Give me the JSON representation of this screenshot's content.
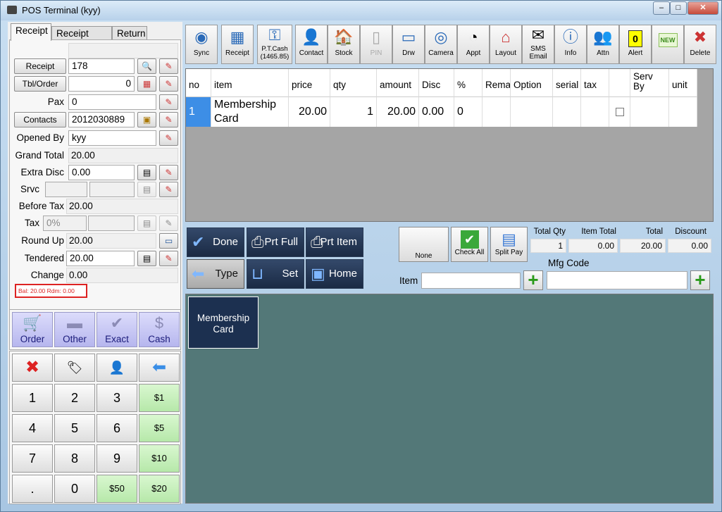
{
  "window": {
    "title": "POS Terminal (kyy)",
    "min": "–",
    "max": "□",
    "close": "✕"
  },
  "tabs": [
    "Receipt",
    "Receipt Info",
    "Return"
  ],
  "form": {
    "top_value": "",
    "receipt_label": "Receipt",
    "receipt_value": "178",
    "tbl_label": "Tbl/Order",
    "tbl_value": "0",
    "pax_label": "Pax",
    "pax_value": "0",
    "contacts_label": "Contacts",
    "contacts_value": "2012030889",
    "opened_by_label": "Opened By",
    "opened_by_value": "kyy",
    "grand_total_label": "Grand Total",
    "grand_total_value": "20.00",
    "extra_disc_label": "Extra Disc",
    "extra_disc_value": "0.00",
    "srvc_label": "Srvc",
    "before_tax_label": "Before Tax",
    "before_tax_value": "20.00",
    "tax_label": "Tax",
    "tax_value": "0%",
    "round_up_label": "Round Up",
    "round_up_value": "20.00",
    "tendered_label": "Tendered",
    "tendered_value": "20.00",
    "change_label": "Change",
    "change_value": "0.00",
    "balance_text": "Bal: 20.00 Rdm: 0.00"
  },
  "payments": [
    "Order",
    "Other",
    "Exact",
    "Cash"
  ],
  "keypad": {
    "digits": [
      "1",
      "2",
      "3",
      "4",
      "5",
      "6",
      "7",
      "8",
      "9",
      ".",
      "0"
    ],
    "money": [
      "$1",
      "$5",
      "$10",
      "$50",
      "$20"
    ]
  },
  "toolbar": [
    {
      "label": "Sync",
      "icon": "sync-icon"
    },
    {
      "label": "Receipt",
      "icon": "receipt-icon"
    },
    {
      "label": "P.T.Cash (1465.85)",
      "icon": "key-icon"
    },
    {
      "label": "Contact",
      "icon": "contact-icon"
    },
    {
      "label": "Stock",
      "icon": "house-icon"
    },
    {
      "label": "PIN",
      "icon": "phone-icon"
    },
    {
      "label": "Drw",
      "icon": "drawer-icon"
    },
    {
      "label": "Camera",
      "icon": "camera-icon"
    },
    {
      "label": "Appt",
      "icon": "appointment-icon"
    },
    {
      "label": "Layout",
      "icon": "shop-icon"
    },
    {
      "label": "SMS Email",
      "icon": "email-icon"
    },
    {
      "label": "Info",
      "icon": "info-icon"
    },
    {
      "label": "Attn",
      "icon": "attendance-icon"
    },
    {
      "label": "Alert",
      "icon": "alert-icon",
      "badge": "0"
    },
    {
      "label": "",
      "icon": "new-icon",
      "badge": "NEW"
    },
    {
      "label": "Delete",
      "icon": "delete-icon"
    }
  ],
  "grid": {
    "columns": [
      "no",
      "item",
      "price",
      "qty",
      "amount",
      "Disc",
      "%",
      "Remark",
      "Option",
      "serial",
      "tax",
      "",
      "Serv By",
      "unit"
    ],
    "rows": [
      {
        "no": "1",
        "item": "Membership Card",
        "price": "20.00",
        "qty": "1",
        "amount": "20.00",
        "disc": "0.00",
        "pct": "0"
      }
    ]
  },
  "actions": [
    "Done",
    "Prt Full",
    "Prt Item",
    "Type",
    "Set",
    "Home"
  ],
  "small_buttons": {
    "none": "None",
    "check_all": "Check All",
    "split_pay": "Split Pay"
  },
  "totals": {
    "labels": [
      "Total Qty",
      "Item Total",
      "Total",
      "Discount"
    ],
    "values": [
      "1",
      "0.00",
      "20.00",
      "0.00"
    ]
  },
  "item_section": {
    "mfg_label": "Mfg Code",
    "item_label": "Item",
    "item_value": "",
    "mfg_value": ""
  },
  "item_tiles": [
    "Membership Card"
  ]
}
